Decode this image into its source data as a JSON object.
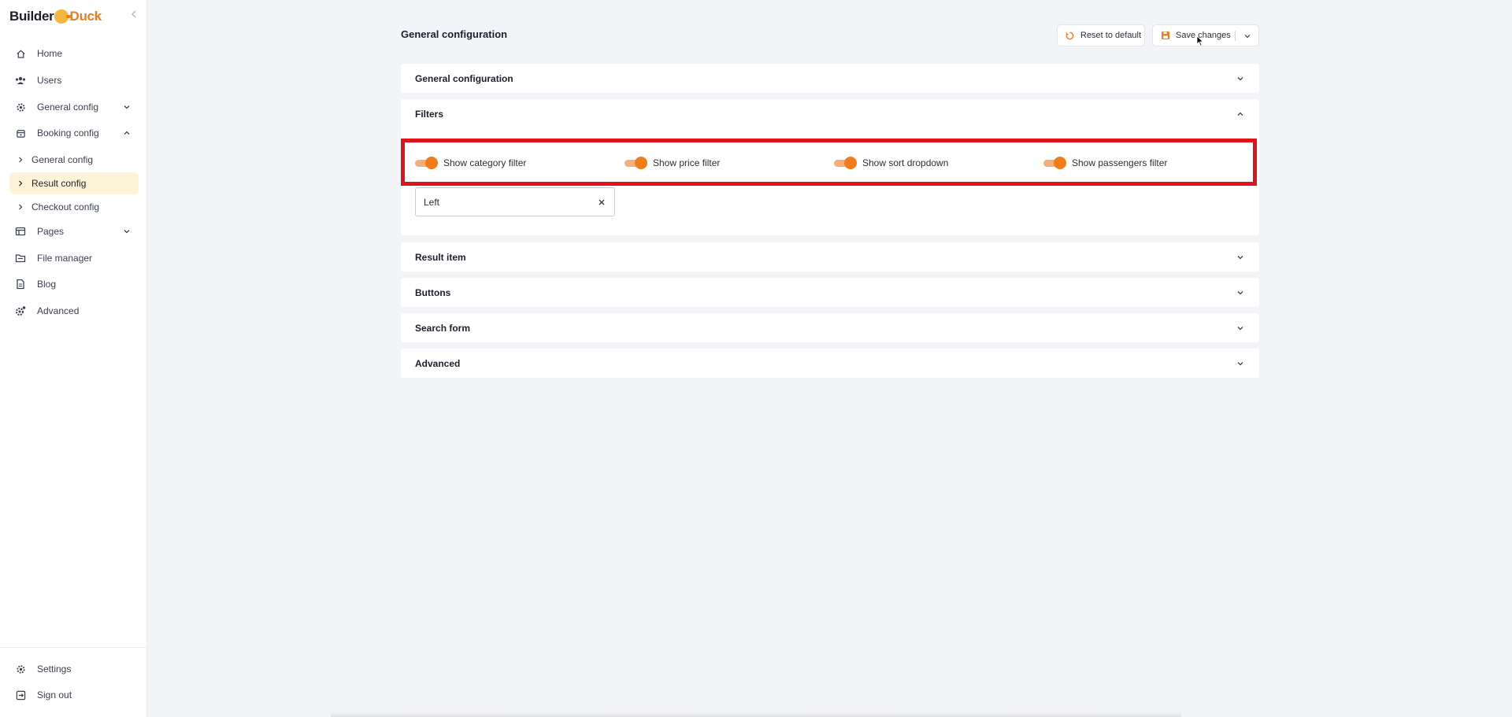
{
  "app": {
    "logo_part1": "Builder",
    "logo_part2": "Duck"
  },
  "sidebar": {
    "items": [
      {
        "label": "Home",
        "icon": "home-icon"
      },
      {
        "label": "Users",
        "icon": "users-icon"
      },
      {
        "label": "General config",
        "icon": "gear-icon"
      },
      {
        "label": "Booking config",
        "icon": "calendar-icon"
      },
      {
        "label": "Pages",
        "icon": "layout-icon"
      },
      {
        "label": "File manager",
        "icon": "folder-icon"
      },
      {
        "label": "Blog",
        "icon": "document-icon"
      },
      {
        "label": "Advanced",
        "icon": "advanced-gear-icon"
      }
    ],
    "sub_items": [
      {
        "label": "General config"
      },
      {
        "label": "Result config",
        "active": true
      },
      {
        "label": "Checkout config"
      }
    ],
    "bottom": [
      {
        "label": "Settings",
        "icon": "gear-icon"
      },
      {
        "label": "Sign out",
        "icon": "sign-out-icon"
      }
    ]
  },
  "header": {
    "title": "General configuration",
    "reset_label": "Reset to default",
    "save_label": "Save changes"
  },
  "sections": [
    {
      "title": "General configuration",
      "expanded": false
    },
    {
      "title": "Filters",
      "expanded": true
    },
    {
      "title": "Result item",
      "expanded": false
    },
    {
      "title": "Buttons",
      "expanded": false
    },
    {
      "title": "Search form",
      "expanded": false
    },
    {
      "title": "Advanced",
      "expanded": false
    }
  ],
  "filters": {
    "toggles": [
      {
        "label": "Show category filter",
        "on": true
      },
      {
        "label": "Show price filter",
        "on": true
      },
      {
        "label": "Show sort dropdown",
        "on": true
      },
      {
        "label": "Show passengers filter",
        "on": true
      }
    ],
    "position_value": "Left"
  },
  "colors": {
    "accent": "#f07c1a",
    "accent_light": "#f5b07a",
    "active_bg": "#fdf3d9",
    "highlight": "#e0121a"
  }
}
